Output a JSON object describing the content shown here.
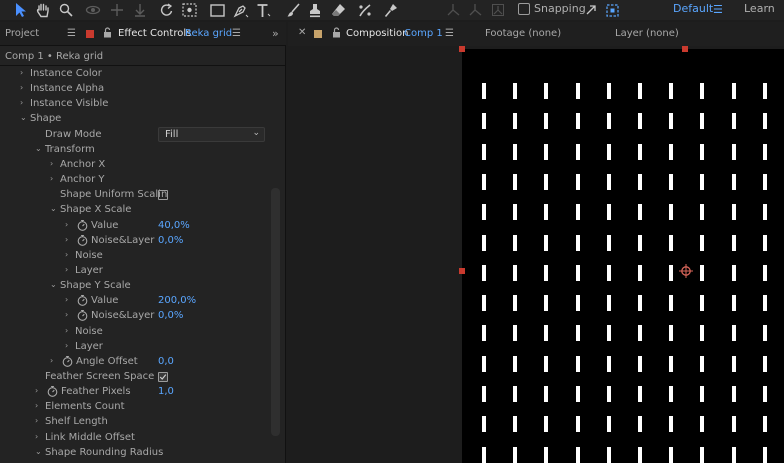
{
  "toolbar": {
    "tools": [
      "selection-tool",
      "hand-tool",
      "zoom-tool",
      "orbit-tool",
      "pan-tool",
      "dolly-tool",
      "rotate-tool",
      "camera-tool",
      "rectangle-tool",
      "pen-tool",
      "type-tool",
      "brush-tool",
      "clone-stamp-tool",
      "eraser-tool",
      "roto-brush-tool",
      "puppet-tool"
    ],
    "snapping_label": "Snapping",
    "workspace_label": "Default",
    "learn_label": "Learn"
  },
  "left_panel": {
    "project_tab": "Project",
    "effect_controls_tab": "Effect Controls",
    "effect_controls_layer": "Reka grid",
    "header": "Comp 1 • Reka grid",
    "properties": [
      {
        "label": "Instance Color",
        "arrow": "›",
        "indent": 0
      },
      {
        "label": "Instance Alpha",
        "arrow": "›",
        "indent": 0
      },
      {
        "label": "Instance Visible",
        "arrow": "›",
        "indent": 0
      },
      {
        "label": "Shape",
        "arrow": "⌄",
        "indent": 0
      },
      {
        "label": "Draw Mode",
        "indent": 1,
        "dropdown": "Fill"
      },
      {
        "label": "Transform",
        "arrow": "⌄",
        "indent": 1
      },
      {
        "label": "Anchor X",
        "arrow": "›",
        "indent": 2
      },
      {
        "label": "Anchor Y",
        "arrow": "›",
        "indent": 2
      },
      {
        "label": "Shape Uniform Scalin",
        "indent": 2,
        "checkbox": false
      },
      {
        "label": "Shape X Scale",
        "arrow": "⌄",
        "indent": 2
      },
      {
        "label": "Value",
        "arrow": "›",
        "indent": 3,
        "stopwatch": true,
        "value": "40,0%"
      },
      {
        "label": "Noise&Layer",
        "arrow": "›",
        "indent": 3,
        "stopwatch": true,
        "value": "0,0%"
      },
      {
        "label": "Noise",
        "arrow": "›",
        "indent": 3
      },
      {
        "label": "Layer",
        "arrow": "›",
        "indent": 3
      },
      {
        "label": "Shape Y Scale",
        "arrow": "⌄",
        "indent": 2
      },
      {
        "label": "Value",
        "arrow": "›",
        "indent": 3,
        "stopwatch": true,
        "value": "200,0%"
      },
      {
        "label": "Noise&Layer",
        "arrow": "›",
        "indent": 3,
        "stopwatch": true,
        "value": "0,0%"
      },
      {
        "label": "Noise",
        "arrow": "›",
        "indent": 3
      },
      {
        "label": "Layer",
        "arrow": "›",
        "indent": 3
      },
      {
        "label": "Angle Offset",
        "arrow": "›",
        "indent": 2,
        "stopwatch": true,
        "value": "0,0"
      },
      {
        "label": "Feather Screen Space",
        "indent": 1,
        "checkbox": true
      },
      {
        "label": "Feather Pixels",
        "arrow": "›",
        "indent": 1,
        "stopwatch": true,
        "value": "1,0"
      },
      {
        "label": "Elements Count",
        "arrow": "›",
        "indent": 1
      },
      {
        "label": "Shelf Length",
        "arrow": "›",
        "indent": 1
      },
      {
        "label": "Link Middle Offset",
        "arrow": "›",
        "indent": 1
      },
      {
        "label": "Shape Rounding Radius",
        "arrow": "⌄",
        "indent": 1
      }
    ]
  },
  "comp_panel": {
    "composition_tab": "Composition",
    "composition_name": "Comp 1",
    "footage_tab": "Footage (none)",
    "layer_tab": "Layer (none)",
    "grid": {
      "columns": 11,
      "rows": 13
    }
  },
  "colors": {
    "accent": "#5aa6ff",
    "handle": "#c93a2e",
    "panel_bg": "#232323",
    "canvas_bg": "#000000"
  }
}
